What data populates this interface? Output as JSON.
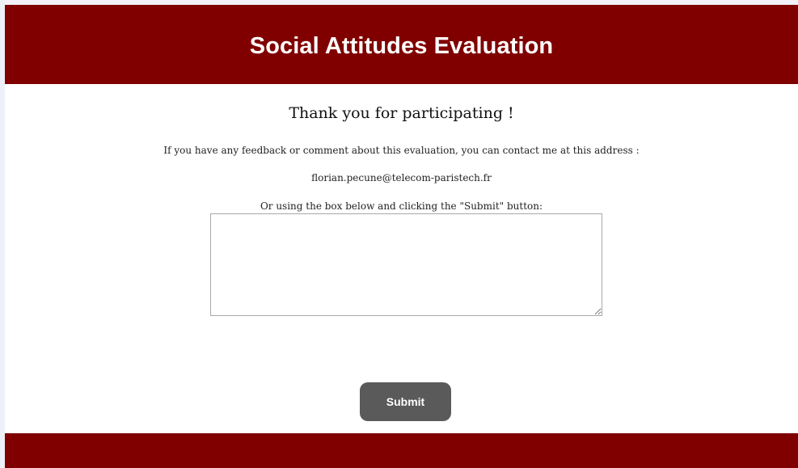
{
  "header": {
    "title": "Social Attitudes Evaluation"
  },
  "main": {
    "thanks_heading": "Thank you for participating !",
    "feedback_text": "If you have any feedback or comment about this evaluation, you can contact me at this address :",
    "contact_email": "florian.pecune@telecom-paristech.fr",
    "box_instruction": "Or using the box below and clicking the \"Submit\" button:",
    "feedback_box_value": "",
    "submit_label": "Submit"
  },
  "colors": {
    "header_bg": "#800000",
    "footer_bg": "#800000",
    "button_bg": "#5a5a5a"
  }
}
